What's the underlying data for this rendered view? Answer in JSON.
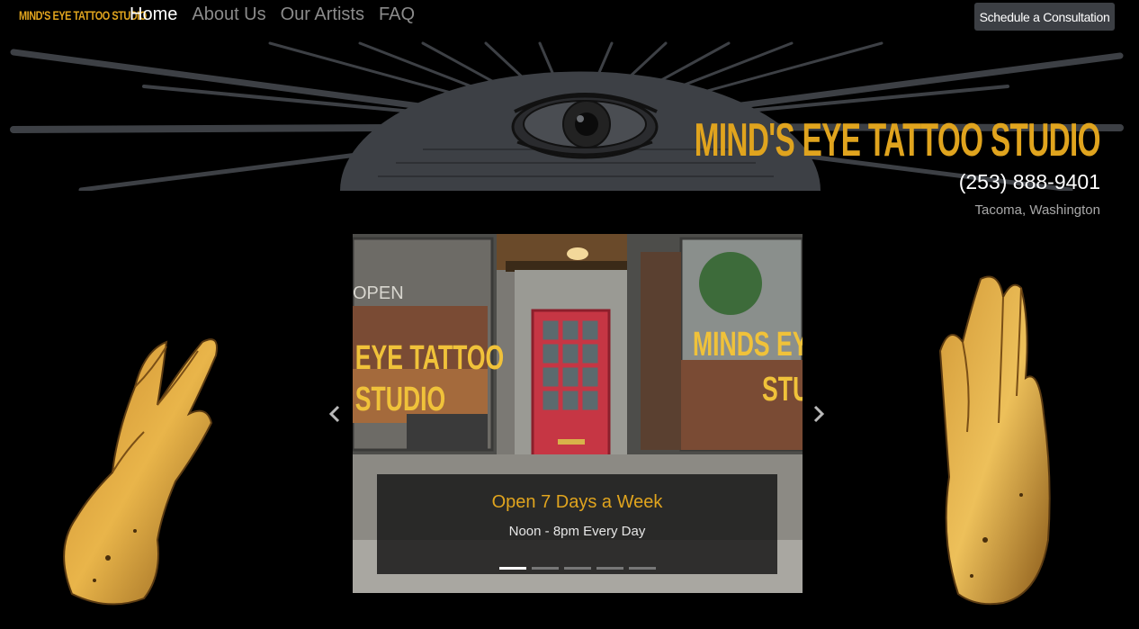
{
  "nav": {
    "brand": "MIND'S EYE TATTOO STUDIO",
    "links": [
      "Home",
      "About Us",
      "Our Artists",
      "FAQ"
    ],
    "active": "Home",
    "cta": "Schedule a Consultation"
  },
  "banner": {
    "studio_name": "MIND'S EYE TATTOO STUDIO",
    "phone": "(253) 888-9401",
    "city": "Tacoma, Washington"
  },
  "carousel": {
    "slide_title": "Open 7 Days a Week",
    "slide_text": "Noon - 8pm Every Day",
    "slide_count": 5,
    "active_slide": 1,
    "window_sign_left": "EYE TATTOO STUDIO",
    "window_sign_right": "MINDS EYE STUDIO",
    "open_sign": "OPEN",
    "prev_icon": "chevron-left-icon",
    "next_icon": "chevron-right-icon"
  },
  "colors": {
    "accent": "#e0a41e",
    "background": "#000000",
    "cta_bg": "#3c3f44",
    "nav_inactive": "#8b8b8b"
  }
}
